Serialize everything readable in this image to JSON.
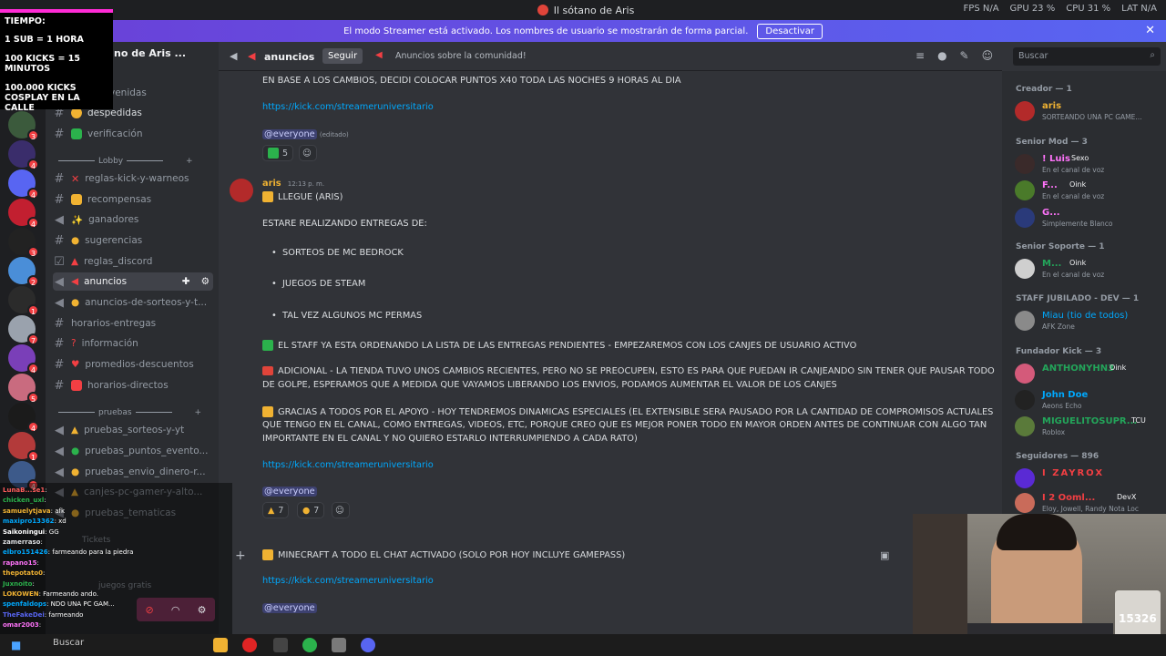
{
  "titlebar": {
    "title": "Il sótano de Aris",
    "fps": "FPS  N/A",
    "gpu": "GPU  23 %",
    "cpu": "CPU  31 %",
    "lat": "LAT  N/A"
  },
  "banner": {
    "text": "El modo Streamer está activado. Los nombres de usuario se mostrarán de forma parcial.",
    "button": "Desactivar",
    "close": "✕"
  },
  "overlay": {
    "lines": [
      "TIEMPO:",
      "1 SUB = 1 HORA",
      "100 KICKS = 15 MINUTOS",
      "100.000 KICKS COSPLAY EN LA CALLE"
    ]
  },
  "server": {
    "name": "no de Aris ..."
  },
  "channels": {
    "items": [
      {
        "label": "despedidas"
      },
      {
        "label": "verificación"
      },
      {
        "label": "reglas-kick-y-warneos"
      },
      {
        "label": "recompensas"
      },
      {
        "label": "ganadores"
      },
      {
        "label": "sugerencias"
      },
      {
        "label": "reglas_discord"
      },
      {
        "label": "anuncios"
      },
      {
        "label": "anuncios-de-sorteos-y-t..."
      },
      {
        "label": "horarios-entregas"
      },
      {
        "label": "información"
      },
      {
        "label": "promedios-descuentos"
      },
      {
        "label": "horarios-directos"
      },
      {
        "label": "pruebas_sorteos-y-yt"
      },
      {
        "label": "pruebas_puntos_evento..."
      },
      {
        "label": "pruebas_envio_dinero-r..."
      },
      {
        "label": "canjes-pc-gamer-y-alto..."
      },
      {
        "label": "pruebas_tematicas"
      }
    ],
    "categories": [
      "Lobby",
      "pruebas",
      "Tickets",
      "juegos gratis"
    ],
    "partial_label": "venidas"
  },
  "header": {
    "channel": "anuncios",
    "follow": "Seguir",
    "topic": "Anuncios sobre la comunidad!",
    "search": "Buscar"
  },
  "messages": {
    "m1_text": "EN BASE A LOS CAMBIOS, DECIDI COLOCAR PUNTOS X40 TODA LAS NOCHES 9 HORAS AL DIA",
    "link": "https://kick.com/streameruniversitario",
    "mention": "@everyone",
    "edited": "(editado)",
    "m1_react": "5",
    "author": "aris",
    "time": "12:13 p. m.",
    "m2_lines": [
      "LLEGUE (ARIS)",
      "ESTARE REALIZANDO ENTREGAS DE:",
      "SORTEOS DE MC BEDROCK",
      "JUEGOS DE STEAM",
      "TAL VEZ ALGUNOS MC PERMAS",
      "EL STAFF YA ESTA ORDENANDO LA LISTA DE LAS ENTREGAS PENDIENTES  - EMPEZAREMOS CON LOS CANJES DE USUARIO ACTIVO",
      "ADICIONAL - LA TIENDA TUVO UNOS CAMBIOS RECIENTES, PERO NO SE PREOCUPEN, ESTO ES PARA QUE PUEDAN IR CANJEANDO SIN TENER QUE PAUSAR TODO",
      "DE GOLPE, ESPERAMOS QUE A MEDIDA QUE VAYAMOS LIBERANDO LOS ENVIOS, PODAMOS AUMENTAR EL VALOR DE LOS CANJES",
      "GRACIAS A TODOS POR EL APOYO - HOY TENDREMOS DINAMICAS ESPECIALES (EL EXTENSIBLE SERA PAUSADO POR LA CANTIDAD DE COMPROMISOS ACTUALES",
      "QUE TENGO EN EL CANAL, COMO ENTREGAS, VIDEOS, ETC, PORQUE CREO QUE ES MEJOR PONER TODO EN MAYOR ORDEN ANTES DE CONTINUAR CON ALGO TAN",
      "IMPORTANTE EN EL CANAL Y NO QUIERO ESTARLO INTERRUMPIENDO A CADA RATO)"
    ],
    "m2_react1": "7",
    "m2_react2": "7",
    "m3_text": "MINECRAFT A TODO EL CHAT ACTIVADO (SOLO POR HOY INCLUYE GAMEPASS)"
  },
  "members": {
    "groups": [
      "Creador — 1",
      "Senior Mod — 3",
      "Senior Soporte — 1",
      "STAFF JUBILADO - DEV — 1",
      "Fundador Kick — 3",
      "Seguidores — 896"
    ],
    "list": [
      {
        "name": "aris",
        "status": "SORTEANDO UNA PC GAME...",
        "color": "#f0b232"
      },
      {
        "name": "! Luis",
        "tag": "Sexo",
        "status": "En el canal de voz",
        "color": "#ff73fa"
      },
      {
        "name": "F...",
        "tag": "Oink",
        "status": "En el canal de voz",
        "color": "#ff73fa"
      },
      {
        "name": "G...",
        "status": "Simplemente Blanco",
        "color": "#ff73fa"
      },
      {
        "name": "M...",
        "tag": "Oink",
        "status": "En el canal de voz",
        "color": "#23a55a"
      },
      {
        "name": "Miau (tio de todos)",
        "status": "AFK Zone",
        "color": "#00a8fc"
      },
      {
        "name": "ANTHONYHN3",
        "tag": "Oink",
        "status": "",
        "color": "#23a55a"
      },
      {
        "name": "John Doe",
        "status": "Aeons Echo",
        "color": "#00a8fc"
      },
      {
        "name": "MIGUELITOSUPR...",
        "tag": "TCU",
        "status": "Roblox",
        "color": "#23a55a"
      },
      {
        "name": "I ZAYROX",
        "status": "",
        "color": "#f23f43"
      },
      {
        "name": "I 2 Ooml...",
        "tag": "DevX",
        "status": "Eloy, Jowell, Randy Nota Loc",
        "color": "#f23f43"
      }
    ]
  },
  "chatlog": [
    [
      "LunaB...se1",
      ":"
    ],
    [
      "chicken_uxl",
      ":"
    ],
    [
      "samuelytjava",
      ": afk"
    ],
    [
      "maxipro13362",
      ": xd"
    ],
    [
      "Saikoningui",
      ": GG"
    ],
    [
      "zamerraso",
      ":"
    ],
    [
      "elbro151426",
      ": farmeando para la piedra"
    ],
    [
      "rapano15",
      ":"
    ],
    [
      "thepotato0",
      ":"
    ],
    [
      "Juxnoito",
      ":"
    ],
    [
      "LOKOWEN",
      ": Farmeando ando."
    ],
    [
      "spenfaldops",
      ": NDO UNA PC GAM..."
    ],
    [
      "TheFakeDei",
      ": farmeando"
    ],
    [
      "omar2003",
      ":"
    ]
  ],
  "webcam": {
    "counter": "15326"
  },
  "taskbar": {
    "search": "Buscar"
  }
}
